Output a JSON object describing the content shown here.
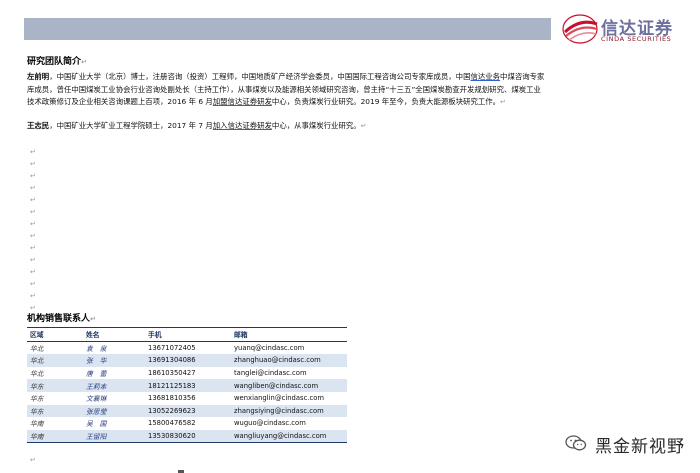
{
  "header": {
    "logo_cn": "信达证券",
    "logo_en": "CINDA SECURITIES"
  },
  "research_team": {
    "title": "研究团队简介",
    "members": [
      {
        "name": "左前明",
        "bio_part1": "，中国矿业大学（北京）博士，注册咨询（投资）工程师，中国地质矿产经济学会委员，中国国际工程咨询公司专家库成员，中国",
        "bio_u1": "信达业务",
        "bio_part2": "中煤咨询专家库成员，曾任中国煤炭工业协会行业咨询处副处长（主持工作），从事煤炭以及能源相关领域研究咨询，曾主持“十三五”全国煤炭勘查开发规划研究、煤炭工业技术政策修订及企业相关咨询课题上百项，2016 年 6 月",
        "bio_u2": "加盟信达证券研发",
        "bio_part3": "中心，负责煤炭行业研究。2019 年至今，负责大能源板块研究工作。"
      },
      {
        "name": "王志民",
        "bio_part1": "，中国矿业大学矿业工程学院硕士，2017 年 7 月",
        "bio_u1": "加入信达证券研发",
        "bio_part2": "中心，从事煤炭行业研究。"
      }
    ]
  },
  "contacts": {
    "title": "机构销售联系人",
    "headers": [
      "区域",
      "姓名",
      "手机",
      "邮箱"
    ],
    "rows": [
      {
        "region": "华北",
        "name": "袁　泉",
        "phone": "13671072405",
        "email": "yuanq@cindasc.com"
      },
      {
        "region": "华北",
        "name": "张　华",
        "phone": "13691304086",
        "email": "zhanghuao@cindasc.com"
      },
      {
        "region": "华北",
        "name": "唐　蕾",
        "phone": "18610350427",
        "email": "tanglei@cindasc.com"
      },
      {
        "region": "华东",
        "name": "王莉本",
        "phone": "18121125183",
        "email": "wangliben@cindasc.com"
      },
      {
        "region": "华东",
        "name": "文襄琳",
        "phone": "13681810356",
        "email": "wenxianglin@cindasc.com"
      },
      {
        "region": "华东",
        "name": "张思莹",
        "phone": "13052269623",
        "email": "zhangsiying@cindasc.com"
      },
      {
        "region": "华南",
        "name": "吴　国",
        "phone": "15800476582",
        "email": "wuguo@cindasc.com"
      },
      {
        "region": "华南",
        "name": "王留阳",
        "phone": "13530830620",
        "email": "wangliuyang@cindasc.com"
      }
    ]
  },
  "watermark": {
    "text": "黑金新视野",
    "icon": "wechat-icon"
  },
  "colors": {
    "header_bar": "#a9b4c6",
    "table_rule": "#1f3864",
    "table_stripe": "#dbe4f1",
    "logo_text": "#6d6f9f",
    "logo_red": "#8a1b2e"
  }
}
